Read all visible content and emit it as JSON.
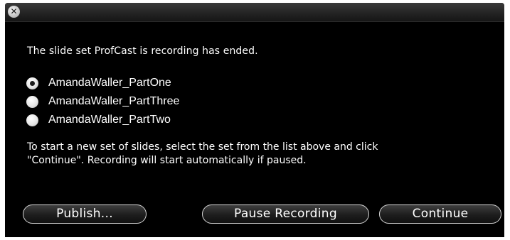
{
  "window": {
    "close_glyph": "✕",
    "icons": {
      "close": "close-icon"
    }
  },
  "message": "The slide set ProfCast is recording has ended.",
  "slide_sets": [
    {
      "label": "AmandaWaller_PartOne",
      "selected": true
    },
    {
      "label": "AmandaWaller_PartThree",
      "selected": false
    },
    {
      "label": "AmandaWaller_PartTwo",
      "selected": false
    }
  ],
  "instructions": {
    "line1": "To start a new set of slides, select the set from the list above and click",
    "line2": "\"Continue\". Recording will start automatically if paused."
  },
  "buttons": {
    "publish": "Publish...",
    "pause": "Pause Recording",
    "continue": "Continue"
  },
  "colors": {
    "background": "#000000",
    "text": "#ffffff",
    "button_border": "#d6d6d6"
  }
}
